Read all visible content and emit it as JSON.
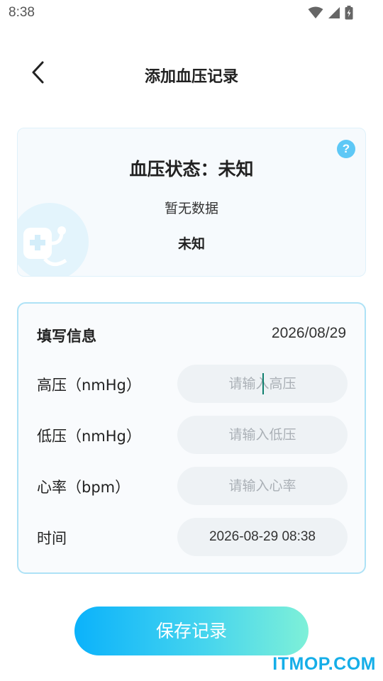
{
  "status_bar": {
    "time": "8:38",
    "icons": [
      "wifi-icon",
      "signal-icon",
      "battery-icon"
    ]
  },
  "header": {
    "title": "添加血压记录",
    "back_icon": "chevron-left-icon"
  },
  "status_card": {
    "title": "血压状态：未知",
    "subtitle": "暂无数据",
    "value": "未知",
    "help_label": "?"
  },
  "form": {
    "title": "填写信息",
    "date": "2026/08/29",
    "rows": [
      {
        "label": "高压（nmHg）",
        "placeholder": "请输入高压",
        "value": ""
      },
      {
        "label": "低压（nmHg）",
        "placeholder": "请输入低压",
        "value": ""
      },
      {
        "label": "心率（bpm）",
        "placeholder": "请输入心率",
        "value": ""
      },
      {
        "label": "时间",
        "placeholder": "",
        "value": "2026-08-29 08:38"
      }
    ]
  },
  "save_button": {
    "label": "保存记录"
  },
  "watermark": "ITMOP.COM",
  "colors": {
    "accent": "#0bb2fb",
    "accent_end": "#7ef0d8",
    "card_border": "#aee2f6",
    "help_icon": "#5ec8f6",
    "watermark": "#15aee8"
  }
}
